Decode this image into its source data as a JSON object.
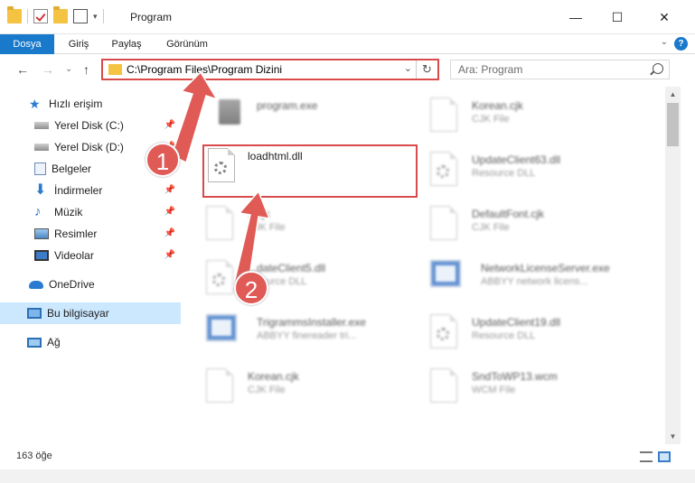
{
  "window": {
    "title": "Program",
    "controls": {
      "minimize": "—",
      "maximize": "☐",
      "close": "✕"
    }
  },
  "ribbon": {
    "tabs": [
      {
        "label": "Dosya"
      },
      {
        "label": "Giriş"
      },
      {
        "label": "Paylaş"
      },
      {
        "label": "Görünüm"
      }
    ],
    "help": "?",
    "collapse": "⌄"
  },
  "nav": {
    "back": "←",
    "forward": "→",
    "recent": "⌄",
    "up": "↑",
    "address": "C:\\Program Files\\Program Dizini",
    "address_dropdown": "⌄",
    "refresh": "↻",
    "search_placeholder": "Ara: Program"
  },
  "sidebar": {
    "items": [
      {
        "label": "Hızlı erişim",
        "icon": "star-icon"
      },
      {
        "label": "Yerel Disk (C:)",
        "icon": "drive-icon",
        "pinned": true
      },
      {
        "label": "Yerel Disk (D:)",
        "icon": "drive-icon",
        "pinned": true
      },
      {
        "label": "Belgeler",
        "icon": "documents-icon",
        "pinned": true
      },
      {
        "label": "İndirmeler",
        "icon": "downloads-icon",
        "pinned": true
      },
      {
        "label": "Müzik",
        "icon": "music-icon",
        "pinned": true
      },
      {
        "label": "Resimler",
        "icon": "pictures-icon",
        "pinned": true
      },
      {
        "label": "Videolar",
        "icon": "videos-icon",
        "pinned": true
      },
      {
        "label": "OneDrive",
        "icon": "cloud-icon"
      },
      {
        "label": "Bu bilgisayar",
        "icon": "computer-icon",
        "selected": true
      },
      {
        "label": "Ağ",
        "icon": "network-icon"
      }
    ]
  },
  "files": [
    {
      "name": "program.exe",
      "type": "",
      "kind": "exe"
    },
    {
      "name": "Korean.cjk",
      "type": "CJK File",
      "kind": "doc"
    },
    {
      "name": "loadhtml.dll",
      "type": "",
      "kind": "dll",
      "highlighted": true
    },
    {
      "name": "UpdateClient63.dll",
      "type": "Resource DLL",
      "kind": "dll"
    },
    {
      "name": "...cjk",
      "type": "CJK File",
      "kind": "doc"
    },
    {
      "name": "DefaultFont.cjk",
      "type": "CJK File",
      "kind": "doc"
    },
    {
      "name": "...dateClient5.dll",
      "type": "...source DLL",
      "kind": "dll"
    },
    {
      "name": "NetworkLicenseServer.exe",
      "type": "ABBYY network licens...",
      "kind": "app"
    },
    {
      "name": "TrigrammsInstaller.exe",
      "type": "ABBYY finereader tri...",
      "kind": "app"
    },
    {
      "name": "UpdateClient19.dll",
      "type": "Resource DLL",
      "kind": "dll"
    },
    {
      "name": "Korean.cjk",
      "type": "CJK File",
      "kind": "doc"
    },
    {
      "name": "SndToWP13.wcm",
      "type": "WCM File",
      "kind": "doc"
    }
  ],
  "status": {
    "count": "163 öğe"
  },
  "annotations": {
    "step1": "1",
    "step2": "2"
  }
}
